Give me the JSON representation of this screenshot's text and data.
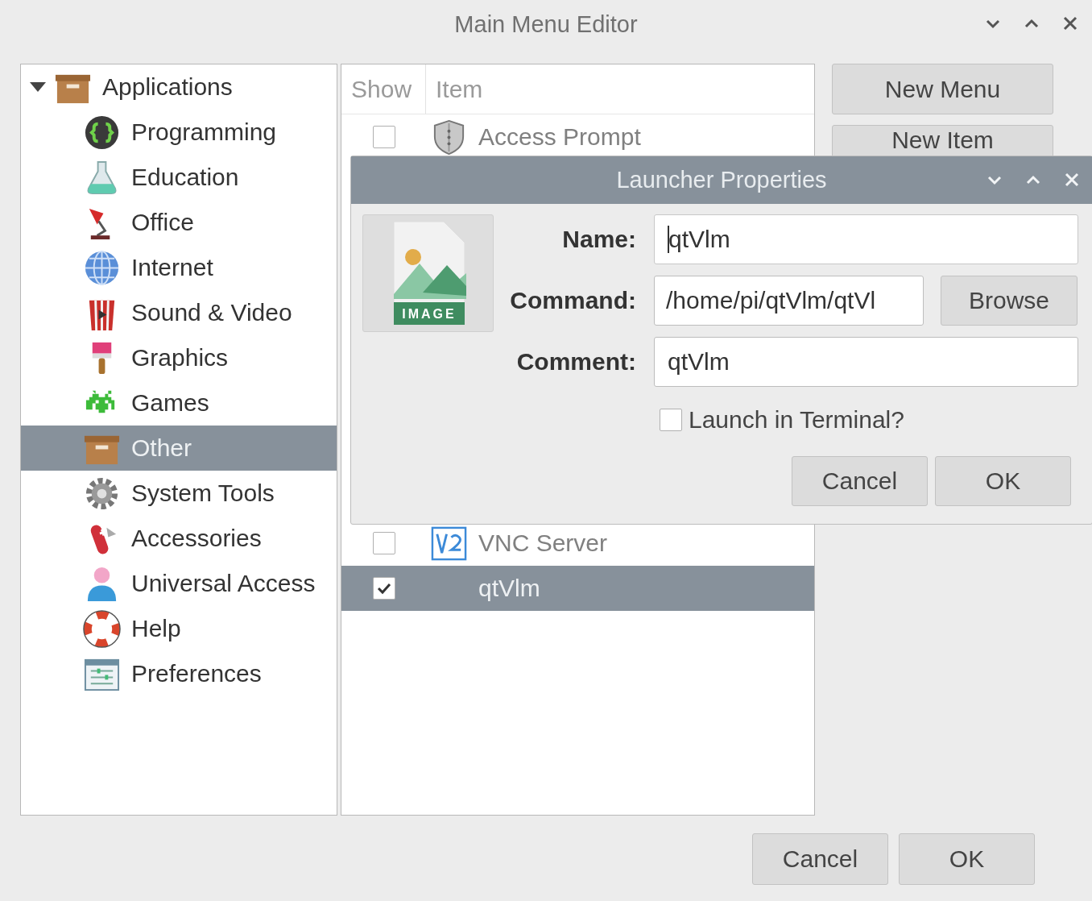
{
  "window": {
    "title": "Main Menu Editor"
  },
  "tree": [
    {
      "label": "Applications",
      "expanded": true,
      "selected": false,
      "children": [
        {
          "label": "Programming",
          "selected": false
        },
        {
          "label": "Education",
          "selected": false
        },
        {
          "label": "Office",
          "selected": false
        },
        {
          "label": "Internet",
          "selected": false
        },
        {
          "label": "Sound & Video",
          "selected": false
        },
        {
          "label": "Graphics",
          "selected": false
        },
        {
          "label": "Games",
          "selected": false
        },
        {
          "label": "Other",
          "selected": true
        },
        {
          "label": "System Tools",
          "selected": false
        },
        {
          "label": "Accessories",
          "selected": false
        },
        {
          "label": "Universal Access",
          "selected": false
        },
        {
          "label": "Help",
          "selected": false
        },
        {
          "label": "Preferences",
          "selected": false
        }
      ]
    }
  ],
  "items": {
    "columns": [
      "Show",
      "Item"
    ],
    "rows": [
      {
        "label": "Access Prompt",
        "show": false,
        "selected": false
      },
      {
        "label": "VNC Server",
        "show": false,
        "selected": false
      },
      {
        "label": "qtVlm",
        "show": true,
        "selected": true
      }
    ]
  },
  "side_buttons": [
    "New Menu",
    "New Item"
  ],
  "buttons": [
    "Cancel",
    "OK"
  ],
  "dialog": {
    "title": "Launcher Properties",
    "icon_label": "IMAGE",
    "fields": [
      {
        "label": "Name:",
        "value": "qtVlm",
        "focused": true
      },
      {
        "label": "Command:",
        "value": "/home/pi/qtVlm/qtVl",
        "focused": false
      },
      {
        "label": "Comment:",
        "value": "qtVlm",
        "focused": false
      }
    ],
    "browse": "Browse",
    "terminal": {
      "label": "Launch in Terminal?",
      "checked": false
    },
    "buttons": [
      "Cancel",
      "OK"
    ]
  }
}
